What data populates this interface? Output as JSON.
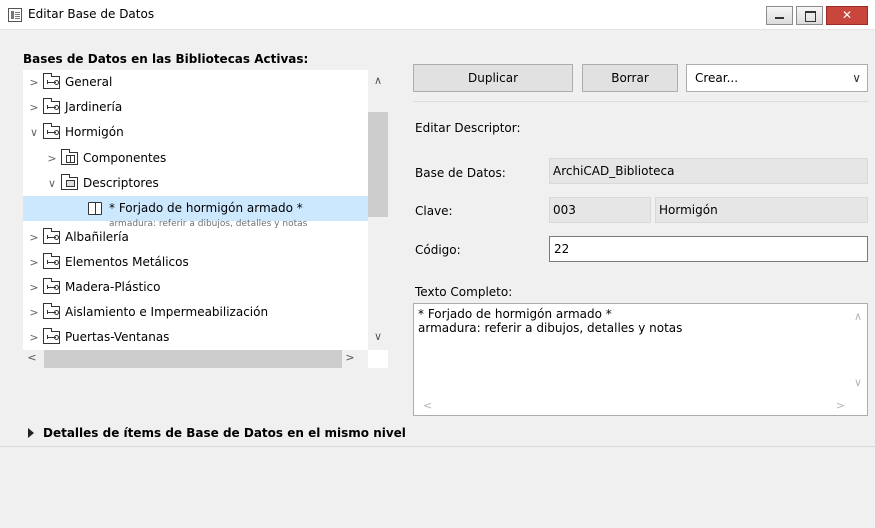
{
  "window": {
    "title": "Editar Base de Datos",
    "close_label": "✕",
    "accent_close": "#c9463d"
  },
  "left": {
    "label": "Bases de Datos en las Bibliotecas Activas:",
    "tree": [
      {
        "label": "General",
        "level": 0,
        "expanded": false,
        "icon": "key-folder-icon"
      },
      {
        "label": "Jardinería",
        "level": 0,
        "expanded": false,
        "icon": "key-folder-icon"
      },
      {
        "label": "Hormigón",
        "level": 0,
        "expanded": true,
        "icon": "key-folder-icon"
      },
      {
        "label": "Componentes",
        "level": 1,
        "expanded": false,
        "icon": "components-folder-icon"
      },
      {
        "label": "Descriptores",
        "level": 1,
        "expanded": true,
        "icon": "descriptors-folder-icon"
      },
      {
        "label": "* Forjado de hormigón armado *",
        "level": 2,
        "selected": true,
        "icon": "book-icon",
        "sub": "armadura: referir a dibujos, detalles y notas"
      },
      {
        "label": "Albañilería",
        "level": 0,
        "expanded": false,
        "icon": "key-folder-icon"
      },
      {
        "label": "Elementos Metálicos",
        "level": 0,
        "expanded": false,
        "icon": "key-folder-icon"
      },
      {
        "label": "Madera-Plástico",
        "level": 0,
        "expanded": false,
        "icon": "key-folder-icon"
      },
      {
        "label": "Aislamiento e Impermeabilización",
        "level": 0,
        "expanded": false,
        "icon": "key-folder-icon"
      },
      {
        "label": "Puertas-Ventanas",
        "level": 0,
        "expanded": false,
        "icon": "key-folder-icon"
      }
    ]
  },
  "right": {
    "duplicate_label": "Duplicar",
    "delete_label": "Borrar",
    "create_label": "Crear...",
    "edit_descriptor_label": "Editar Descriptor:",
    "database_label": "Base de Datos:",
    "database_value": "ArchiCAD_Biblioteca",
    "key_label": "Clave:",
    "key_value": "003",
    "key_name": "Hormigón",
    "code_label": "Código:",
    "code_value": "22",
    "full_text_label": "Texto Completo:",
    "full_text": "* Forjado de hormigón armado *\narmadura: referir a dibujos, detalles y notas"
  },
  "details": {
    "label": "Detalles de ítems de Base de Datos en el mismo nivel"
  }
}
